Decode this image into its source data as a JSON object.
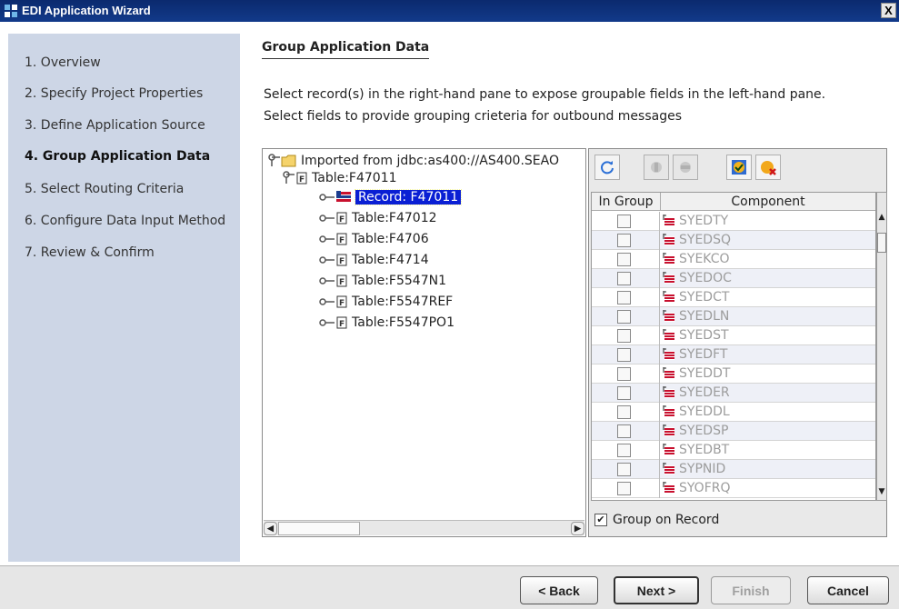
{
  "window": {
    "title": "EDI Application Wizard",
    "close_glyph": "X"
  },
  "steps": [
    {
      "label": "1. Overview",
      "active": false
    },
    {
      "label": "2. Specify Project Properties",
      "active": false
    },
    {
      "label": "3. Define Application Source",
      "active": false
    },
    {
      "label": "4. Group Application Data",
      "active": true
    },
    {
      "label": "5. Select Routing Criteria",
      "active": false
    },
    {
      "label": "6. Configure Data Input Method",
      "active": false
    },
    {
      "label": "7. Review & Confirm",
      "active": false
    }
  ],
  "main": {
    "title": "Group Application Data",
    "line1": "Select record(s) in the right-hand pane to expose groupable fields in the left-hand pane.",
    "line2": "Select fields to provide grouping crieteria for outbound messages"
  },
  "tree": {
    "root": "Imported from jdbc:as400://AS400.SEAO",
    "table": "Table:F47011",
    "record": "Record: F47011",
    "tables": [
      "Table:F47012",
      "Table:F4706",
      "Table:F4714",
      "Table:F5547N1",
      "Table:F5547REF",
      "Table:F5547PO1"
    ]
  },
  "grid": {
    "col_ingroup": "In Group",
    "col_component": "Component",
    "fields": [
      "SYEDTY",
      "SYEDSQ",
      "SYEKCO",
      "SYEDOC",
      "SYEDCT",
      "SYEDLN",
      "SYEDST",
      "SYEDFT",
      "SYEDDT",
      "SYEDER",
      "SYEDDL",
      "SYEDSP",
      "SYEDBT",
      "SYPNID",
      "SYOFRQ"
    ]
  },
  "group_on_record": {
    "label": "Group on Record",
    "checked": true
  },
  "buttons": {
    "back": "< Back",
    "next": "Next >",
    "finish": "Finish",
    "cancel": "Cancel"
  },
  "icons": [
    "refresh-icon",
    "add-group-icon",
    "remove-group-icon",
    "select-all-icon",
    "clear-all-icon"
  ]
}
